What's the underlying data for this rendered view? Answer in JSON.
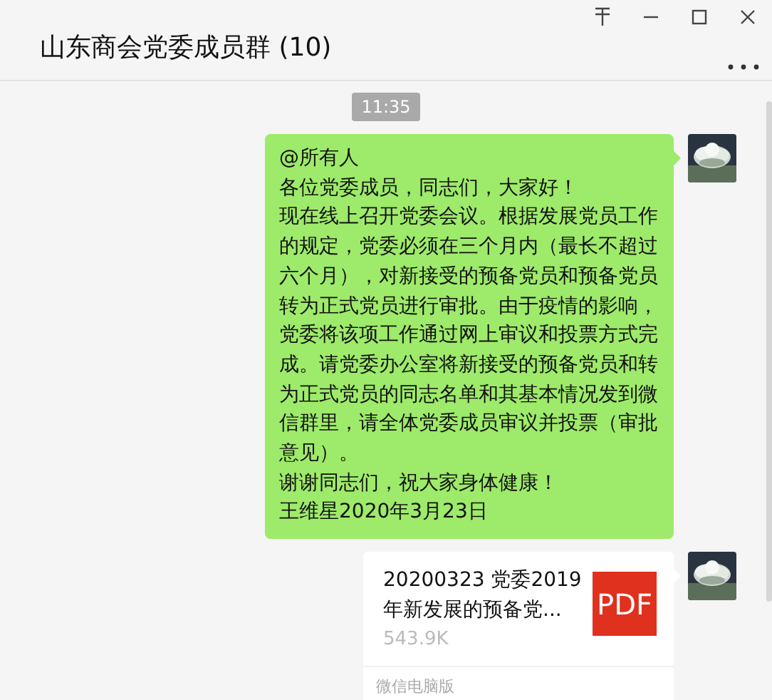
{
  "window": {
    "title": "山东商会党委成员群 (10)"
  },
  "timestamp": "11:35",
  "messages": [
    {
      "kind": "text",
      "paragraphs": [
        "@所有人",
        "各位党委成员，同志们，大家好！",
        "现在线上召开党委会议。根据发展党员工作的规定，党委必须在三个月内（最长不超过六个月），对新接受的预备党员和预备党员转为正式党员进行审批。由于疫情的影响，党委将该项工作通过网上审议和投票方式完成。请党委办公室将新接受的预备党员和转为正式党员的同志名单和其基本情况发到微信群里，请全体党委成员审议并投票（审批意见）。",
        "谢谢同志们，祝大家身体健康！",
        "王维星2020年3月23日"
      ]
    },
    {
      "kind": "file",
      "name_lines": [
        "20200323 党委2019",
        "年新发展的预备党..."
      ],
      "size": "543.9K",
      "file_type": "PDF",
      "source": "微信电脑版"
    }
  ]
}
